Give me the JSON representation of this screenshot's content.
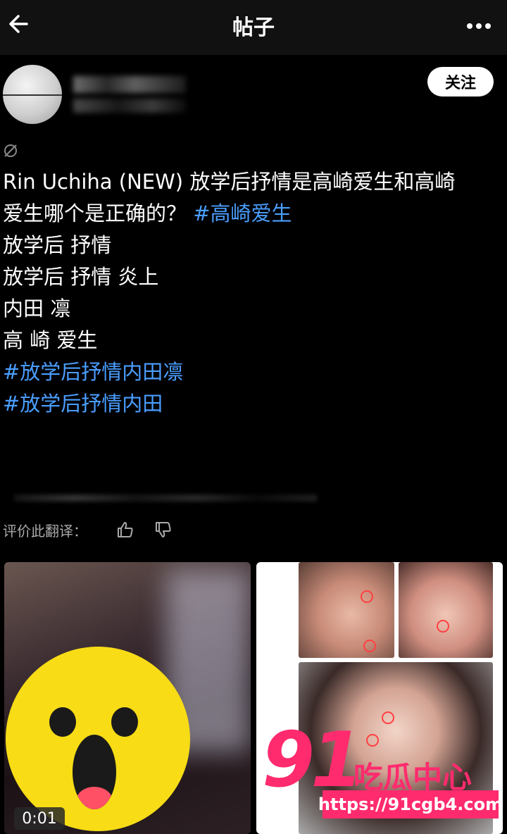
{
  "header": {
    "title": "帖子",
    "back_icon": "arrow-left-icon",
    "more_icon": "more-horizontal-icon"
  },
  "author": {
    "follow_label": "关注"
  },
  "post": {
    "lines": [
      [
        {
          "text": "Rin Uchiha (NEW) 放学后抒情是高崎爱生和高崎",
          "tag": false
        }
      ],
      [
        {
          "text": "爱生哪个是正确的？ ",
          "tag": false
        },
        {
          "text": "#高崎爱生",
          "tag": true
        }
      ],
      [
        {
          "text": " ",
          "tag": false
        }
      ],
      [
        {
          "text": "放学后 抒情",
          "tag": false
        }
      ],
      [
        {
          "text": "放学后 抒情 炎上",
          "tag": false
        }
      ],
      [
        {
          "text": "内田 凛",
          "tag": false
        }
      ],
      [
        {
          "text": "高 崎 爱生",
          "tag": false
        }
      ],
      [
        {
          "text": "#放学后抒情内田凛",
          "tag": true
        }
      ],
      [
        {
          "text": "#放学后抒情内田",
          "tag": true
        }
      ]
    ],
    "hashtag_color": "#4a9eff"
  },
  "translation": {
    "rate_label": "评价此翻译："
  },
  "media": {
    "video_duration": "0:01"
  },
  "watermark": {
    "number": "91",
    "text": "吃瓜中心",
    "url": "https://91cgb4.com",
    "color": "#ff2b6e"
  }
}
